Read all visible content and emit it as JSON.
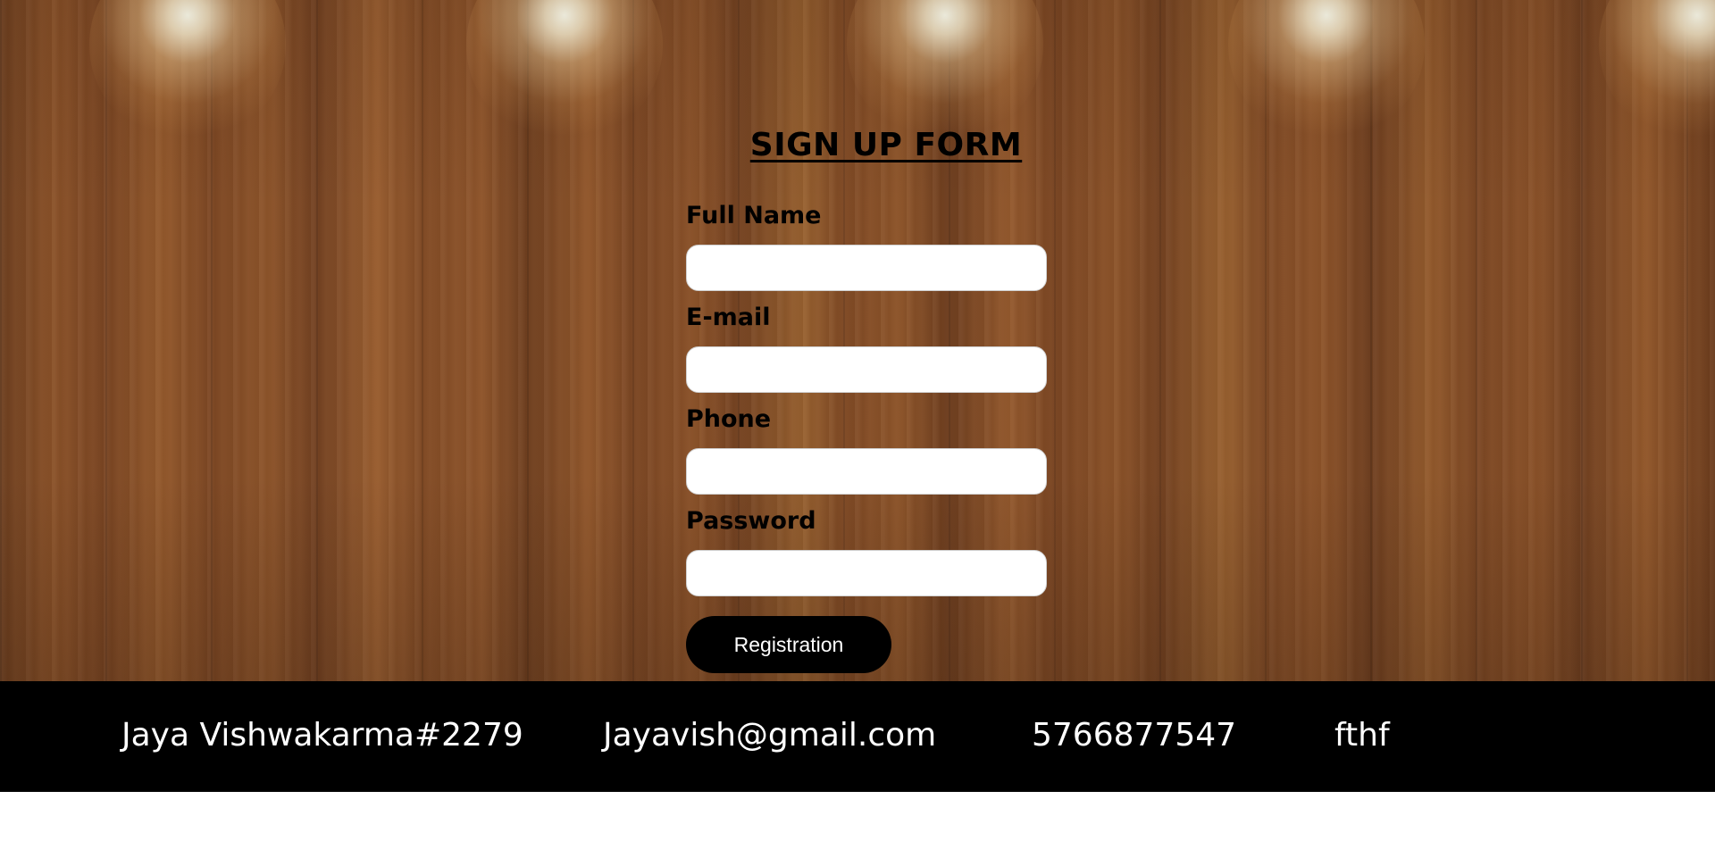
{
  "form": {
    "title": "SIGN UP FORM",
    "fields": [
      {
        "label": "Full Name",
        "value": "",
        "placeholder": ""
      },
      {
        "label": "E-mail",
        "value": "",
        "placeholder": ""
      },
      {
        "label": "Phone",
        "value": "",
        "placeholder": ""
      },
      {
        "label": "Password",
        "value": "",
        "placeholder": ""
      }
    ],
    "submit_label": "Registration"
  },
  "footer": {
    "items": [
      "Jaya Vishwakarma#2279",
      "Jayavish@gmail.com",
      "5766877547",
      "fthf"
    ]
  },
  "colors": {
    "footer_bg": "#000000",
    "button_bg": "#000000",
    "button_text": "#ffffff",
    "wood_tone": "#8a5128"
  }
}
